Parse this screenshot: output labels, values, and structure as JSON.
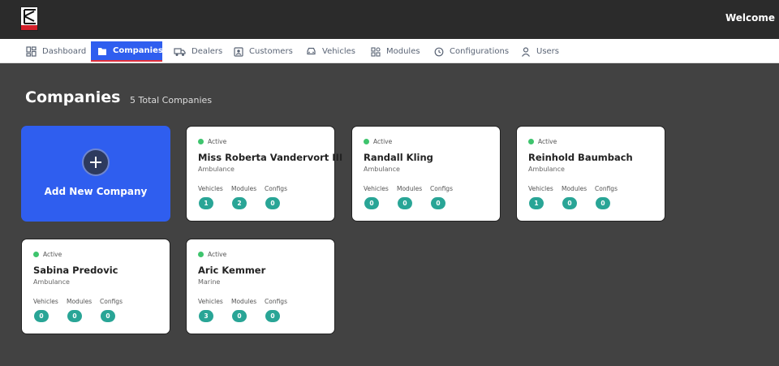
{
  "header": {
    "welcome": "Welcome"
  },
  "nav": [
    {
      "label": "Dashboard",
      "icon": "dashboard-icon",
      "active": false
    },
    {
      "label": "Companies",
      "icon": "companies-icon",
      "active": true
    },
    {
      "label": "Dealers",
      "icon": "truck-icon",
      "active": false
    },
    {
      "label": "Customers",
      "icon": "customers-icon",
      "active": false
    },
    {
      "label": "Vehicles",
      "icon": "car-icon",
      "active": false
    },
    {
      "label": "Modules",
      "icon": "modules-icon",
      "active": false
    },
    {
      "label": "Configurations",
      "icon": "configurations-icon",
      "active": false
    },
    {
      "label": "Users",
      "icon": "user-icon",
      "active": false
    }
  ],
  "page": {
    "title": "Companies",
    "total": "5 Total Companies"
  },
  "add_card": {
    "label": "Add New Company"
  },
  "stat_labels": {
    "vehicles": "Vehicles",
    "modules": "Modules",
    "configs": "Configs"
  },
  "companies": [
    {
      "status": "Active",
      "name": "Miss Roberta Vandervort III",
      "type": "Ambulance",
      "vehicles": "1",
      "modules": "2",
      "configs": "0"
    },
    {
      "status": "Active",
      "name": "Randall Kling",
      "type": "Ambulance",
      "vehicles": "0",
      "modules": "0",
      "configs": "0"
    },
    {
      "status": "Active",
      "name": "Reinhold Baumbach",
      "type": "Ambulance",
      "vehicles": "1",
      "modules": "0",
      "configs": "0"
    },
    {
      "status": "Active",
      "name": "Sabina Predovic",
      "type": "Ambulance",
      "vehicles": "0",
      "modules": "0",
      "configs": "0"
    },
    {
      "status": "Active",
      "name": "Aric Kemmer",
      "type": "Marine",
      "vehicles": "3",
      "modules": "0",
      "configs": "0"
    }
  ],
  "colors": {
    "accent": "#2f5eef",
    "badge": "#29a596",
    "status_active": "#3ec46d",
    "background": "#424242",
    "topbar": "#2b2b2b"
  }
}
